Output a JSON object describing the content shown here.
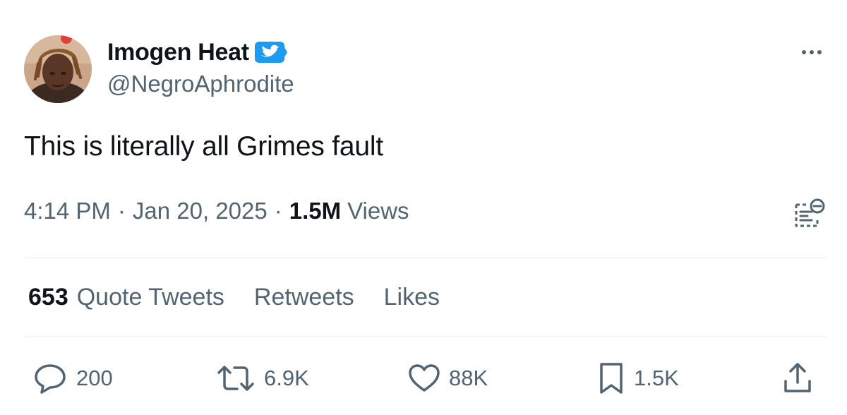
{
  "author": {
    "display_name": "Imogen Heat",
    "handle": "@NegroAphrodite",
    "verified": true
  },
  "tweet": {
    "text": "This is literally all Grimes fault"
  },
  "meta": {
    "time": "4:14 PM",
    "date": "Jan 20, 2025",
    "separator": "·",
    "views_count": "1.5M",
    "views_label": "Views"
  },
  "stats": {
    "quote_tweets_count": "653",
    "quote_tweets_label": "Quote Tweets",
    "retweets_label": "Retweets",
    "likes_label": "Likes"
  },
  "actions": {
    "reply_count": "200",
    "retweet_count": "6.9K",
    "like_count": "88K",
    "bookmark_count": "1.5K"
  },
  "icons": {
    "more": "more-horizontal-icon",
    "verified": "verified-badge-icon",
    "translate": "translate-icon",
    "reply": "reply-icon",
    "retweet": "retweet-icon",
    "like": "heart-icon",
    "bookmark": "bookmark-icon",
    "share": "share-icon"
  },
  "colors": {
    "text_primary": "#0f1419",
    "text_secondary": "#536471",
    "verified_blue": "#1d9bf0",
    "divider": "#eff3f4"
  }
}
